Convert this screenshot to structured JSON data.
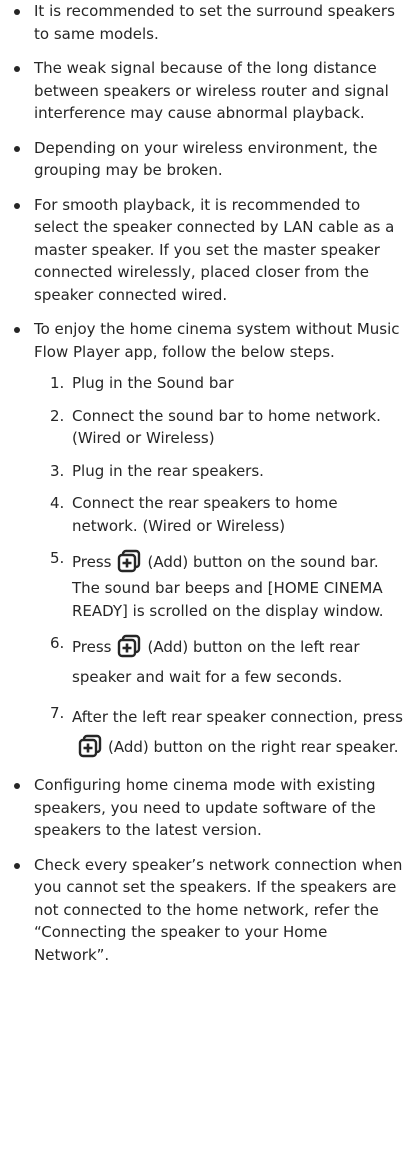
{
  "bullets": [
    "It is recommended to set the surround speakers to same models.",
    "The weak signal because of the long distance between speakers or wireless router and signal interference may cause abnormal playback.",
    "Depending on your wireless environment, the grouping may be broken.",
    "For smooth playback, it is recommended to select the speaker connected by LAN cable as a master speaker. If you set the master speaker connected wirelessly, placed closer from the speaker connected wired.",
    "To enjoy the home cinema system without Music Flow Player app, follow the below steps.",
    "Configuring home cinema mode with existing speakers, you need to update software of the speakers to the latest version.",
    "Check every speaker’s network connection when you cannot set the speakers. If the speakers are not connected to the home network, refer the “Connecting the speaker to your Home Network”."
  ],
  "steps": [
    {
      "num": "1.",
      "text": "Plug in the Sound bar"
    },
    {
      "num": "2.",
      "text": "Connect the sound bar to home network. (Wired or Wireless)"
    },
    {
      "num": "3.",
      "text": "Plug in the rear speakers."
    },
    {
      "num": "4.",
      "text": "Connect the rear speakers to home network. (Wired or Wireless)"
    },
    {
      "num": "5.",
      "pre": "Press",
      "post": "(Add) button on the sound bar.",
      "note": "The sound bar beeps and [HOME CINEMA READY] is scrolled on the display window."
    },
    {
      "num": "6.",
      "pre": "Press",
      "post": "(Add) button on the left rear speaker and wait for a few seconds."
    },
    {
      "num": "7.",
      "pre": "After the left rear speaker connection, press",
      "post": "(Add) button on the right rear speaker."
    }
  ],
  "icons": {
    "add": "add-icon"
  }
}
